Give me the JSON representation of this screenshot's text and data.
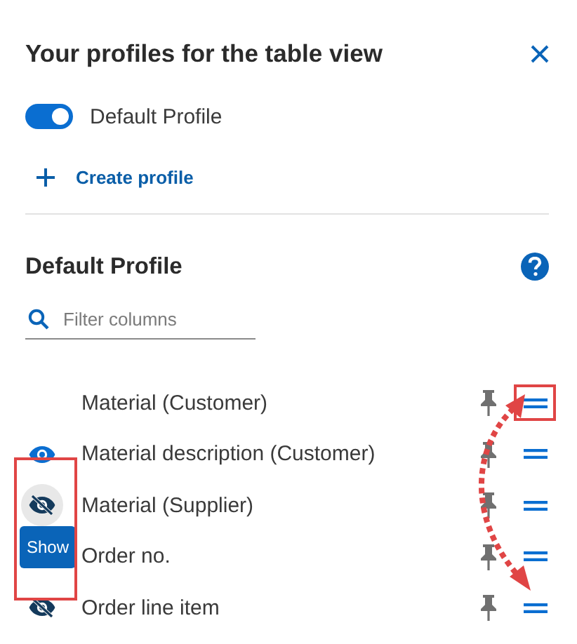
{
  "header": {
    "title": "Your profiles for the table view"
  },
  "profile_toggle": {
    "label": "Default Profile",
    "on": true
  },
  "create_link": {
    "label": "Create profile"
  },
  "section": {
    "title": "Default Profile"
  },
  "filter": {
    "placeholder": "Filter columns"
  },
  "columns": [
    {
      "label": "Material (Customer)",
      "kind": "plain",
      "hovered": false,
      "handle_marked": true
    },
    {
      "label": "Material description (Customer)",
      "kind": "shown",
      "hovered": false,
      "handle_marked": false
    },
    {
      "label": "Material (Supplier)",
      "kind": "hidden",
      "hovered": true,
      "handle_marked": false,
      "tooltip": "Show"
    },
    {
      "label": "Order no.",
      "kind": "plain",
      "hovered": false,
      "handle_marked": false
    },
    {
      "label": "Order line item",
      "kind": "hidden",
      "hovered": false,
      "handle_marked": false
    }
  ],
  "drag_arrow": true
}
